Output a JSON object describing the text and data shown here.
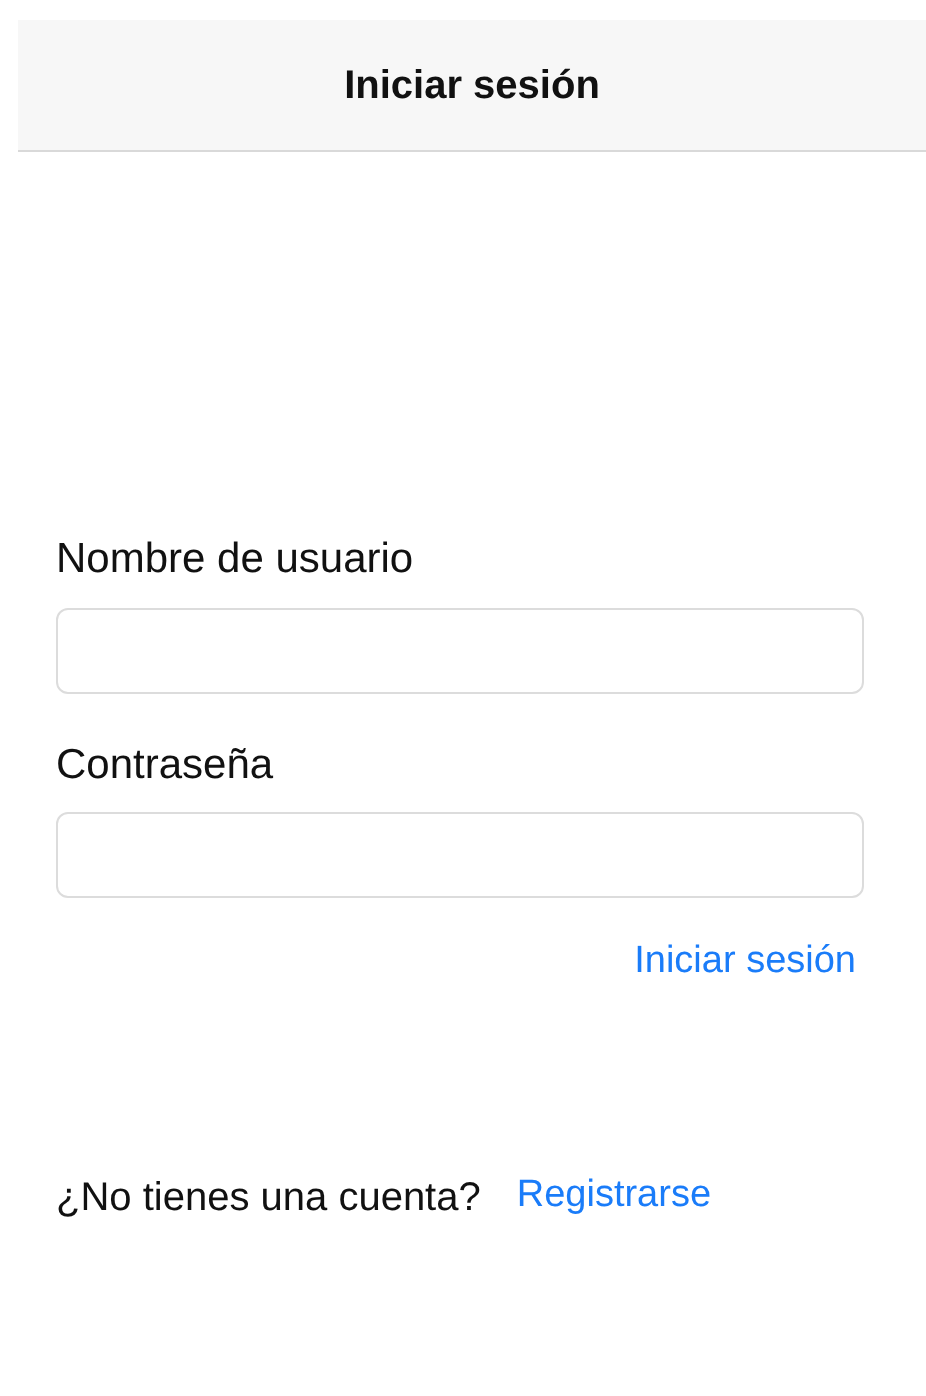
{
  "nav_bar": {
    "title": "Iniciar sesión"
  },
  "fields": [
    {
      "label": "Nombre de usuario"
    },
    {
      "label": "Contraseña"
    }
  ],
  "login_link": "Iniciar sesión",
  "register_prompt": {
    "text": "¿No tienes una cuenta?",
    "link": "Registrarse"
  }
}
